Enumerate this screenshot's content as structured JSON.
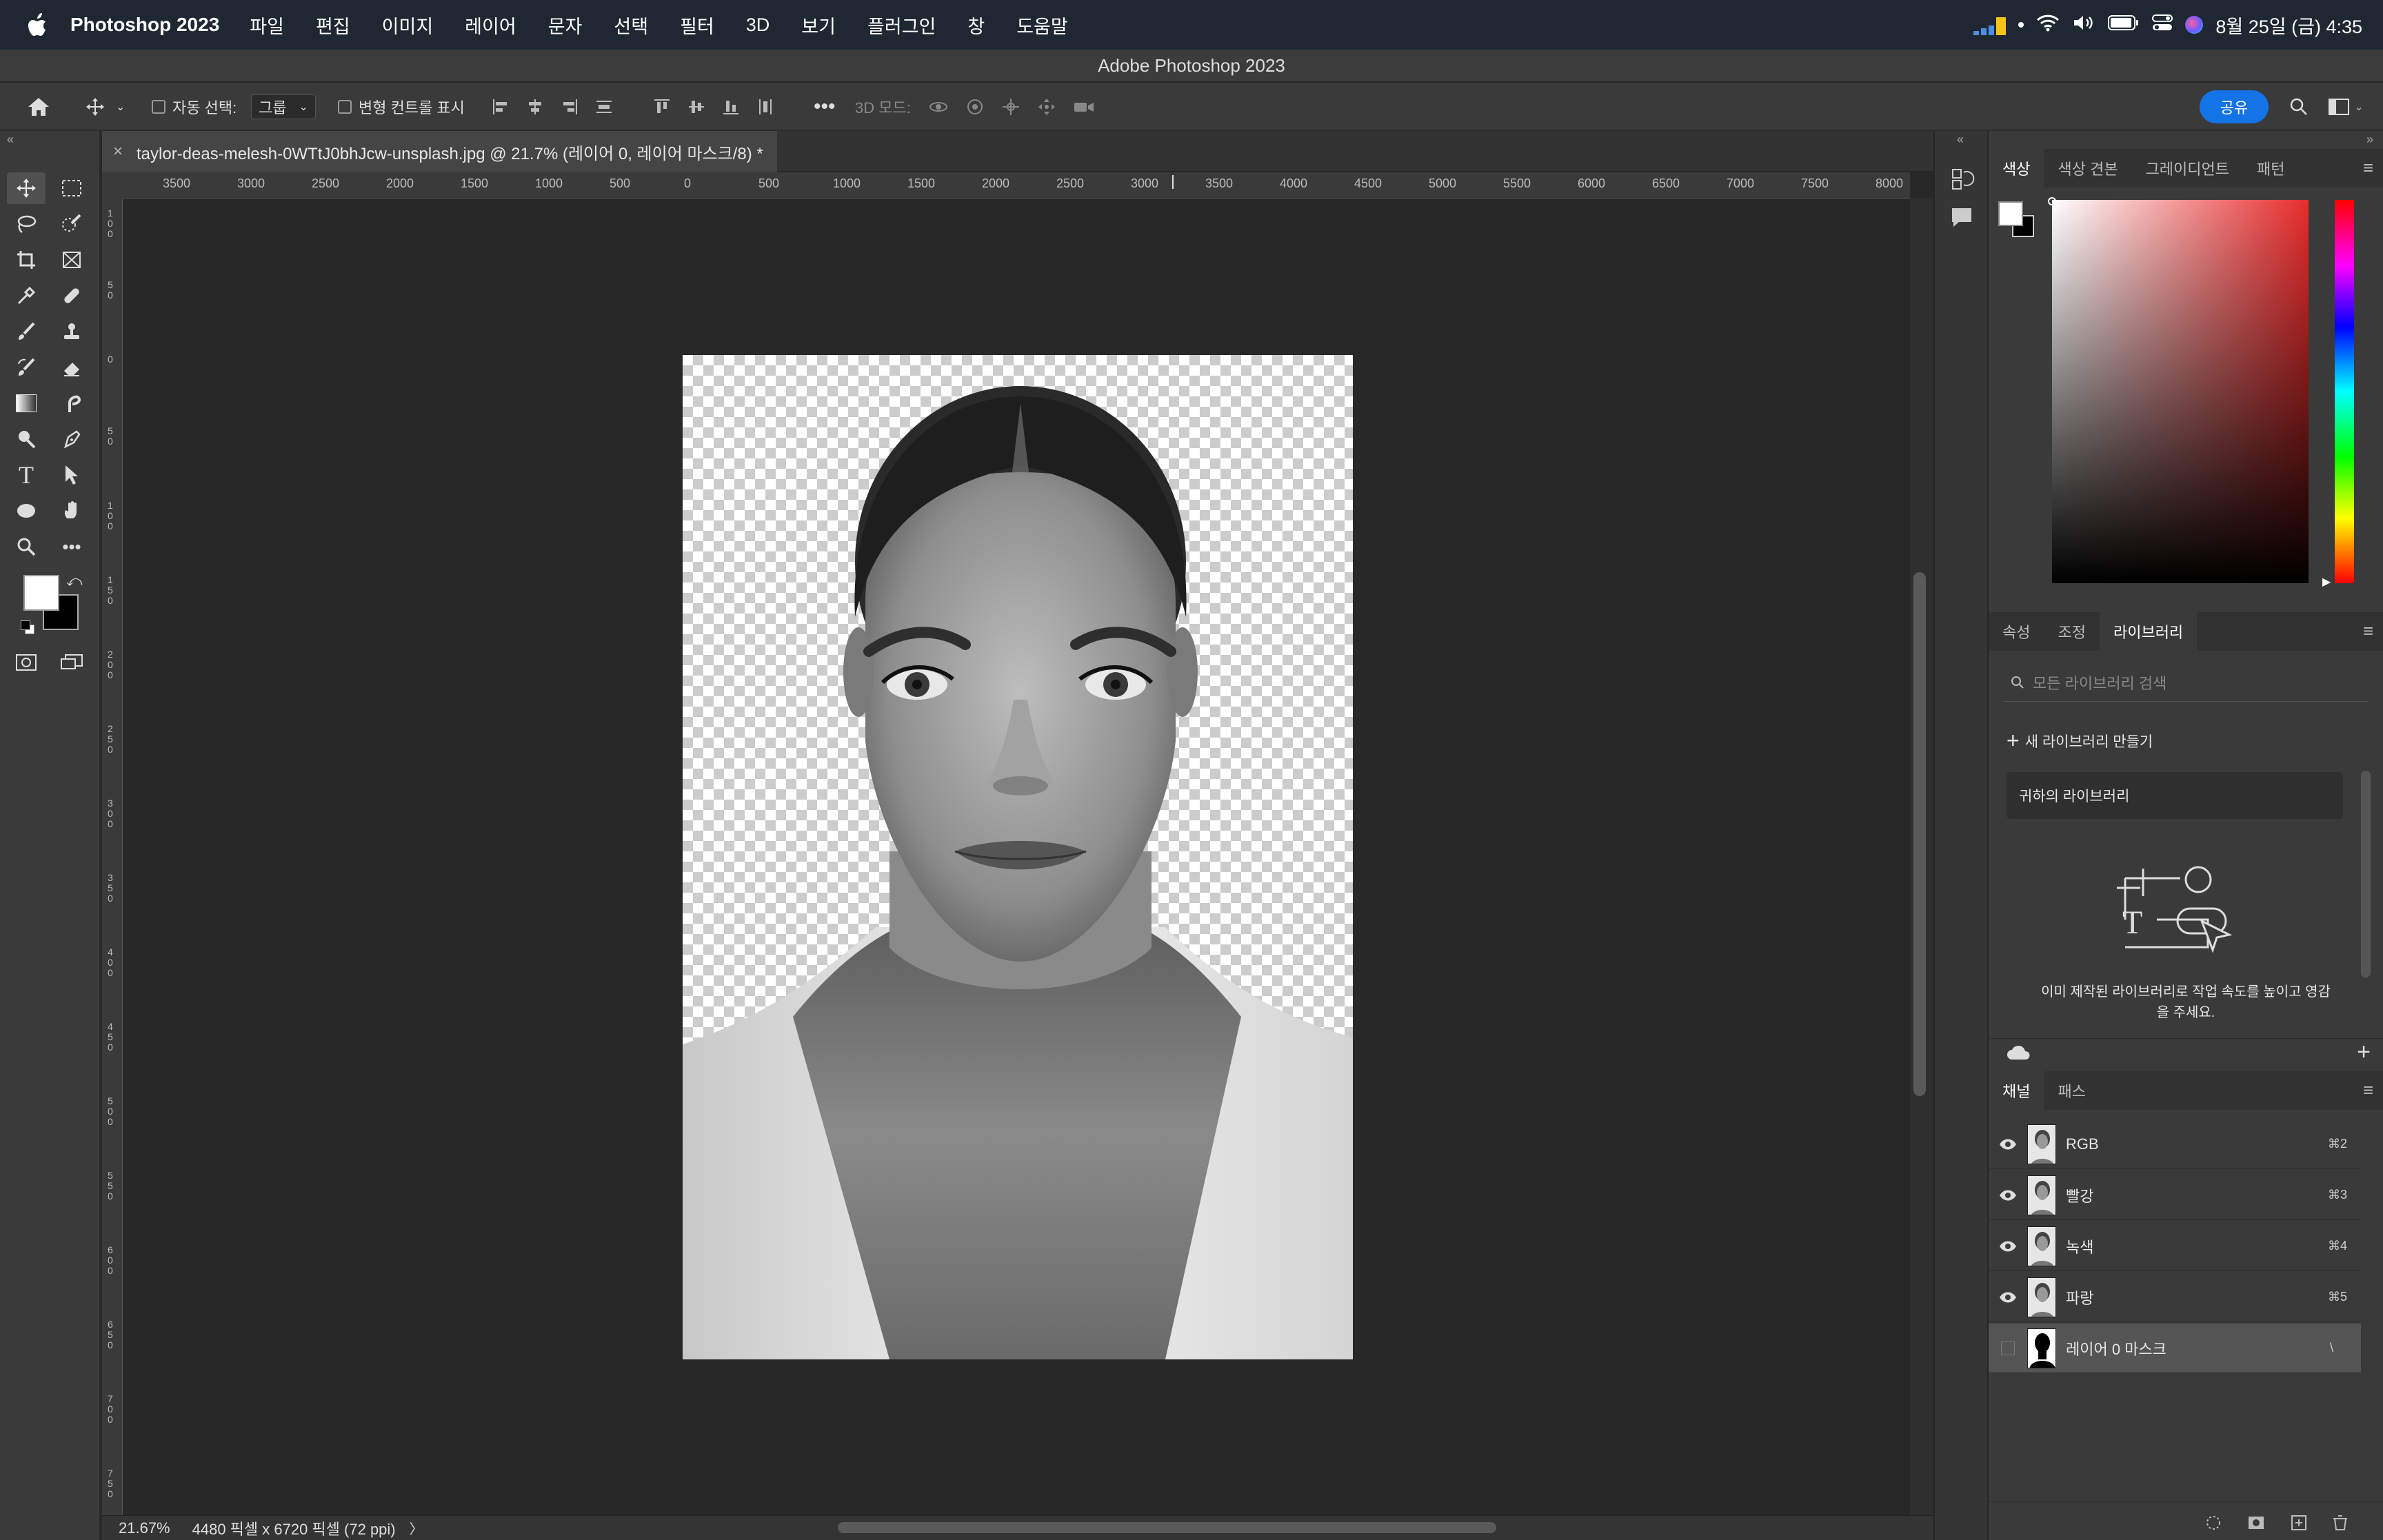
{
  "menubar": {
    "app_name": "Photoshop 2023",
    "items": [
      "파일",
      "편집",
      "이미지",
      "레이어",
      "문자",
      "선택",
      "필터",
      "3D",
      "보기",
      "플러그인",
      "창",
      "도움말"
    ],
    "clock": "8월 25일 (금)  4:35"
  },
  "window": {
    "title": "Adobe Photoshop 2023"
  },
  "options": {
    "auto_select_label": "자동 선택:",
    "auto_select_value": "그룹",
    "transform_label": "변형 컨트롤 표시",
    "mode_3d": "3D 모드:",
    "share": "공유"
  },
  "document": {
    "tab_title": "taylor-deas-melesh-0WTtJ0bhJcw-unsplash.jpg @ 21.7% (레이어 0, 레이어 마스크/8) *",
    "zoom": "21.67%",
    "info": "4480 픽셀 x 6720 픽셀 (72 ppi)",
    "info_arrow": "〉"
  },
  "ruler": {
    "h_labels": [
      "3500",
      "3000",
      "2500",
      "2000",
      "1500",
      "1000",
      "500",
      "0",
      "500",
      "1000",
      "1500",
      "2000",
      "2500",
      "3000",
      "3500",
      "4000",
      "4500",
      "5000",
      "5500",
      "6000",
      "6500",
      "7000",
      "7500",
      "8000"
    ],
    "v_labels": [
      "100",
      "50",
      "0",
      "50",
      "100",
      "150",
      "200",
      "250",
      "300",
      "350",
      "400",
      "450",
      "500",
      "550",
      "600",
      "650",
      "700",
      "750"
    ]
  },
  "color_panel": {
    "tabs": [
      "색상",
      "색상 견본",
      "그레이디언트",
      "패턴"
    ],
    "hue_color": "#e82c2c"
  },
  "library_panel": {
    "tabs": [
      "속성",
      "조정",
      "라이브러리"
    ],
    "search_placeholder": "모든 라이브러리 검색",
    "new_library": "새 라이브러리 만들기",
    "your_library": "귀하의 라이브러리",
    "promo_line1": "이미 제작된 라이브러리로 작업 속도를 높이고 영감",
    "promo_line2": "을 주세요."
  },
  "channels_panel": {
    "tabs": [
      "채널",
      "패스"
    ],
    "rows": [
      {
        "name": "RGB",
        "shortcut": "⌘2"
      },
      {
        "name": "빨강",
        "shortcut": "⌘3"
      },
      {
        "name": "녹색",
        "shortcut": "⌘4"
      },
      {
        "name": "파랑",
        "shortcut": "⌘5"
      },
      {
        "name": "레이어 0 마스크",
        "shortcut": "\\"
      }
    ]
  }
}
